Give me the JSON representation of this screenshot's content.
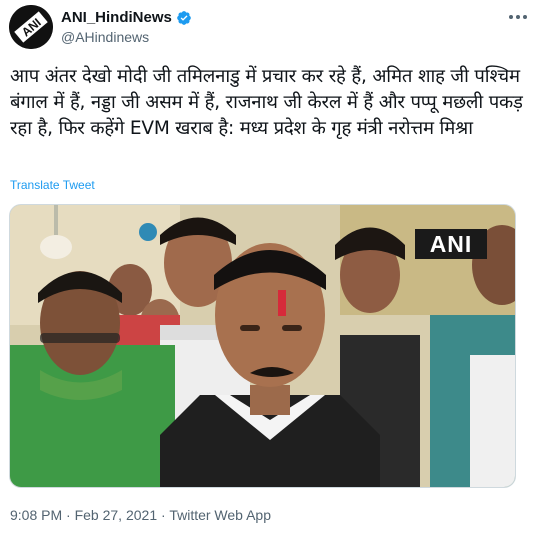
{
  "author": {
    "display_name": "ANI_HindiNews",
    "handle": "@AHindinews",
    "verified": true,
    "avatar_text": "ANI"
  },
  "tweet": {
    "text": "आप अंतर देखो मोदी जी तमिलनाडु में प्रचार कर रहे हैं, अमित शाह जी पश्चिम बंगाल में हैं, नड्डा जी असम में हैं, राजनाथ जी केरल में हैं और पप्पू मछली पकड़ रहा है, फिर कहेंगे EVM खराब है: मध्य प्रदेश के गृह मंत्री नरोत्तम मिश्रा",
    "translate_label": "Translate Tweet"
  },
  "media": {
    "watermark": "ANI"
  },
  "meta": {
    "time": "9:08 PM",
    "separator1": " · ",
    "date": "Feb 27, 2021",
    "separator2": " · ",
    "source": "Twitter Web App"
  },
  "colors": {
    "link": "#1d9bf0",
    "secondary": "#536471",
    "verified": "#1d9bf0"
  },
  "icons": {
    "more": "more-horizontal-icon",
    "verified": "verified-badge-icon"
  }
}
